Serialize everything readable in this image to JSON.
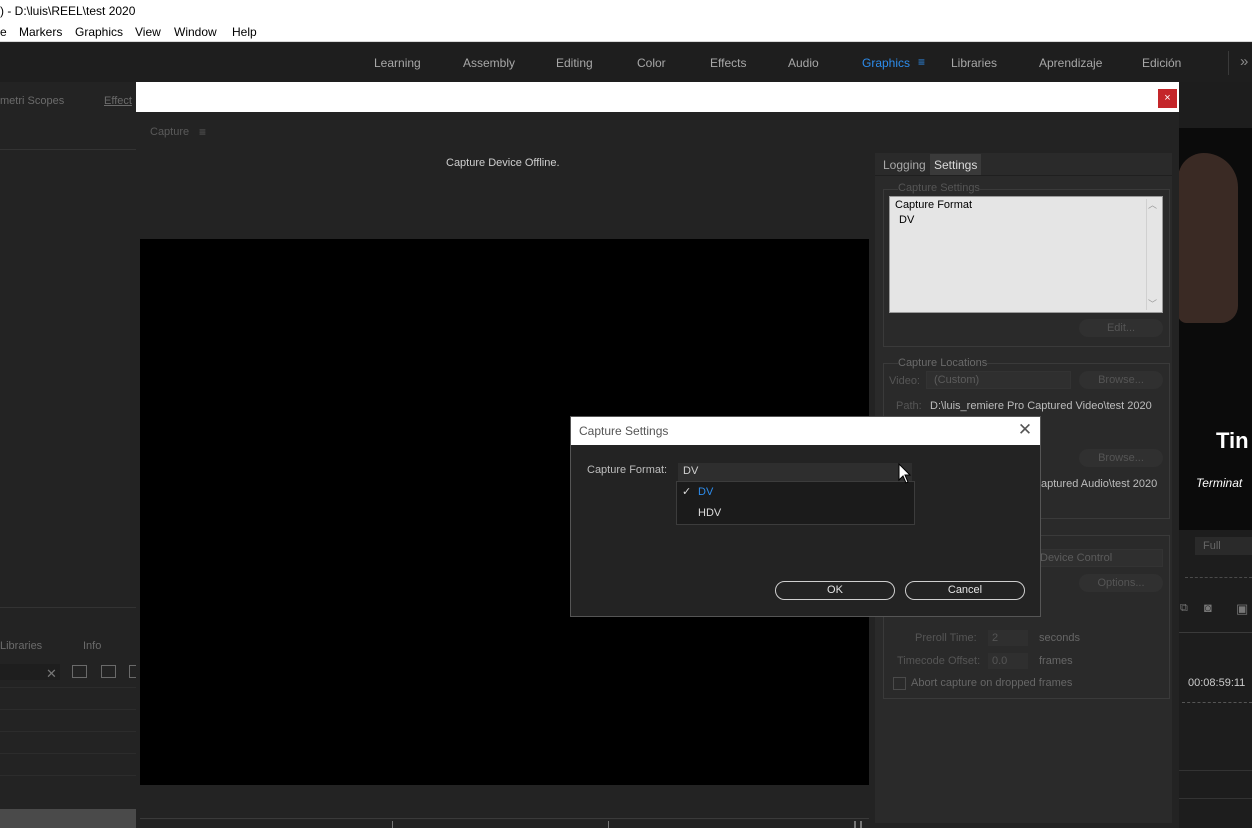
{
  "window": {
    "title": ") - D:\\luis\\REEL\\test 2020",
    "menu": [
      "e",
      "Markers",
      "Graphics",
      "View",
      "Window",
      "Help"
    ]
  },
  "workspaces": {
    "items": [
      "Learning",
      "Assembly",
      "Editing",
      "Color",
      "Effects",
      "Audio",
      "Graphics",
      "Libraries",
      "Aprendizaje",
      "Edición"
    ],
    "active": "Graphics",
    "overflow": "»"
  },
  "left_panel": {
    "tab_scopes": "metri Scopes",
    "tab_effect": "Effect",
    "tab_libraries": "Libraries",
    "tab_info": "Info"
  },
  "capture": {
    "panel_label": "Capture",
    "menu_icon": "≡",
    "close_label": "×",
    "status": "Capture Device Offline."
  },
  "settings_panel": {
    "tabs": [
      "Logging",
      "Settings"
    ],
    "active_tab": "Settings",
    "capture_settings": {
      "legend": "Capture Settings",
      "format_heading": "Capture Format",
      "format_value": "DV",
      "edit_button": "Edit..."
    },
    "capture_locations": {
      "legend": "Capture Locations",
      "video_label": "Video:",
      "video_value": "(Custom)",
      "browse_label": "Browse...",
      "path_label": "Path:",
      "video_path": "D:\\luis_remiere Pro Captured Video\\test 2020",
      "audio_path": "aptured Audio\\test 2020"
    },
    "device_control": {
      "device_value": "Device Control",
      "options_button": "Options...",
      "preroll_label": "Preroll Time:",
      "preroll_value": "2",
      "preroll_unit": "seconds",
      "timecode_label": "Timecode Offset:",
      "timecode_value": "0.0",
      "timecode_unit": "frames",
      "abort_label": "Abort capture on dropped frames",
      "abort_checked": false
    }
  },
  "right_panel": {
    "title_fragment": "Tin",
    "subtitle_fragment": "Terminat",
    "zoom": "Full",
    "timecode": "00:08:59:11"
  },
  "dialog": {
    "title": "Capture Settings",
    "format_label": "Capture Format:",
    "format_selected": "DV",
    "options": [
      {
        "label": "DV",
        "checked": true
      },
      {
        "label": "HDV",
        "checked": false
      }
    ],
    "ok_label": "OK",
    "cancel_label": "Cancel"
  },
  "colors": {
    "accent": "#2d8ceb",
    "close_red": "#c4262a",
    "panel_bg": "#232323"
  }
}
